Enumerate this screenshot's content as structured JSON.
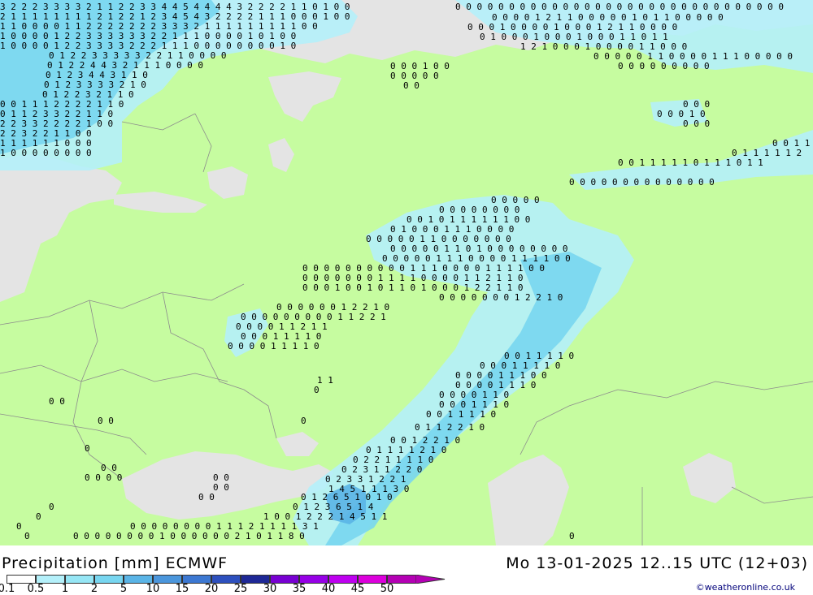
{
  "title": {
    "product": "Precipitation [mm] ECMWF",
    "valid": "Mo 13-01-2025 12..15 UTC (12+03)"
  },
  "credit": "©weatheronline.co.uk",
  "legend": {
    "labels": [
      "0.1",
      "0.5",
      "1",
      "2",
      "5",
      "10",
      "15",
      "20",
      "25",
      "30",
      "35",
      "40",
      "45",
      "50"
    ],
    "colors": [
      "#ffffff",
      "#b4f0fa",
      "#96e6f5",
      "#78d6f0",
      "#5ab4e6",
      "#4b96dc",
      "#3c78d2",
      "#2d50be",
      "#1e2896",
      "#7800d2",
      "#9600e6",
      "#be00f0",
      "#dc00dc",
      "#b400b4"
    ]
  },
  "map_colors": {
    "land": "#c6fca0",
    "water": "#e4e4e4",
    "precip_light": "#b4f0fa",
    "precip_med": "#78d6f0",
    "precip_heavy": "#5ab4e6",
    "border": "#8c8c8c"
  },
  "grid_labels": [
    {
      "text": "3 2 2 2 3 3 3 3 2 1 1 2 2 3 3 4 4 5 4 4 4 4 3 2 2 2 2 1 1 0 1 0 0",
      "row": 0
    },
    {
      "text": "2 1 1 1 1 1 1 1 1 2 1 2 2 1 2 3 4 5 4 3 2 2 2 2 1 1 1 0 0   0 1 0 0",
      "row": 1
    },
    {
      "text": "1 1 0 0 0 0 1 1 2 2 2 2 2 2 2 3 3 3 2 1 1 1 1 1 1 1 1 1 0 0",
      "row": 2
    },
    {
      "text": "1 0 0 0 0 1 2 2 3 3 3 3 3 3 2 2 1 1 1 0 0 0 0 1 0 1 0 0",
      "row": 3
    },
    {
      "text": "1 0 0 0 0 1 2 2 3 3 3 3 2 2 2 1 1 1 0 0 0 0 0 0 0 0 1 0",
      "row": 4
    },
    {
      "text": "0 1 2 2 3 3 3 3 3 2 2 1 1 0 0 0 0",
      "row": 5
    },
    {
      "text": "0 1 2 2 4 4 3 2 1 1 1 0 0 0 0",
      "row": 6
    },
    {
      "text": "0 1 2 3 4 4 3 1 1 0",
      "row": 7
    },
    {
      "text": "0 1 2 3 3 3 3 2 1 0",
      "row": 8
    },
    {
      "text": "0 1 2 2 3 2 1 1 0",
      "row": 9
    },
    {
      "text": "0 0 1 1 1 2 2 2 2 1 1 0",
      "row": 10
    },
    {
      "text": "0 1 1 2 3 3 2 2 1 1 0",
      "row": 11
    },
    {
      "text": "2 2 3 3 2 2 2 2 1 0 0",
      "row": 12
    },
    {
      "text": "2 2 3 2 2 1 1 0 0",
      "row": 13
    },
    {
      "text": "1 1 1 1 1 1 0 0 0",
      "row": 14
    },
    {
      "text": "1 0 0 0 0 0 0 0 0",
      "row": 15
    }
  ]
}
